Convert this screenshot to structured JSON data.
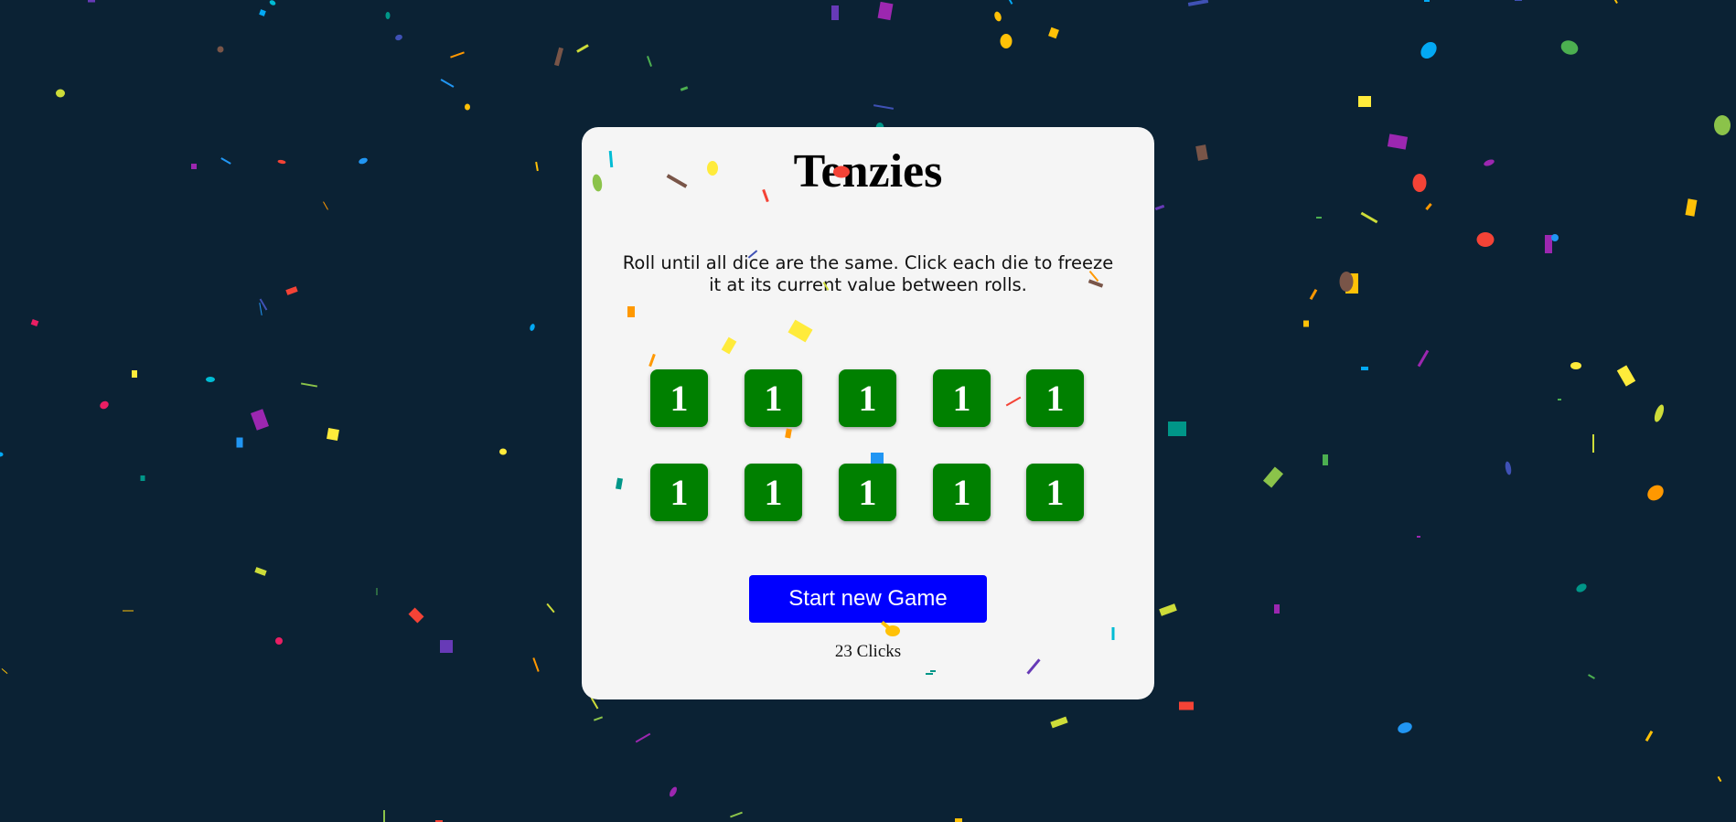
{
  "game": {
    "title": "Tenzies",
    "instructions": "Roll until all dice are the same. Click each die to freeze it at its current value between rolls.",
    "dice": [
      "1",
      "1",
      "1",
      "1",
      "1",
      "1",
      "1",
      "1",
      "1",
      "1"
    ],
    "new_game_label": "Start new Game",
    "click_count_text": "23 Clicks"
  },
  "colors": {
    "background": "#0b2234",
    "card": "#f5f5f5",
    "die_held": "#008000",
    "button": "#0000ff"
  },
  "decor": {
    "confetti_colors": [
      "#f44336",
      "#e91e63",
      "#9c27b0",
      "#673ab7",
      "#3f51b5",
      "#2196f3",
      "#03a9f4",
      "#00bcd4",
      "#009688",
      "#4caf50",
      "#8bc34a",
      "#cddc39",
      "#ffeb3b",
      "#ffc107",
      "#ff9800",
      "#795548"
    ]
  }
}
